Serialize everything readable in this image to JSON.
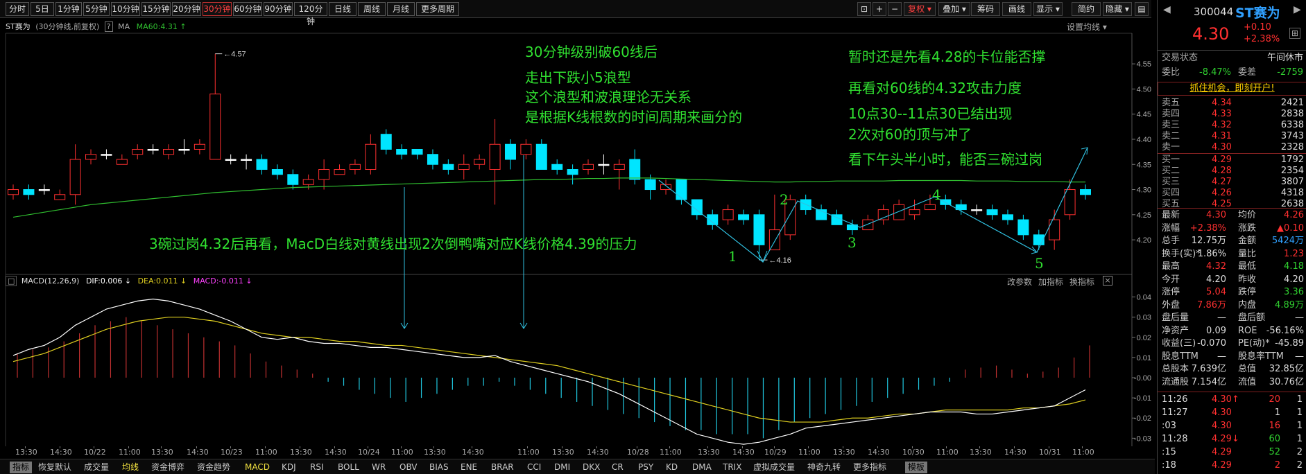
{
  "toolbar": {
    "periods": [
      "分时",
      "5日",
      "1分钟",
      "5分钟",
      "10分钟",
      "15分钟",
      "20分钟",
      "30分钟",
      "60分钟",
      "90分钟",
      "120分钟",
      "日线",
      "周线",
      "月线",
      "更多周期"
    ],
    "active_period": "30分钟",
    "right_buttons": [
      "复权",
      "叠加",
      "筹码",
      "画线",
      "显示",
      "简约",
      "隐藏"
    ]
  },
  "chart_header": {
    "stock_name": "ST赛为",
    "info": "(30分钟线,前复权)",
    "ma_label": "MA",
    "ma_value": "MA60:4.31",
    "settings": "设置均线"
  },
  "price_axis": [
    "4.55",
    "4.50",
    "4.45",
    "4.40",
    "4.35",
    "4.30",
    "4.25",
    "4.20"
  ],
  "high_label": "4.57",
  "low_label": "4.16",
  "annotations": {
    "a1": "30分钟级别破60线后",
    "a2": "走出下跌小5浪型",
    "a3": "这个浪型和波浪理论无关系",
    "a4": "是根据K线根数的时间周期来画分的",
    "a5": "暂时还是先看4.28的卡位能否撑",
    "a6": "再看对60线的4.32攻击力度",
    "a7": "10点30--11点30已结出现",
    "a8": "2次对60的顶与冲了",
    "a9": "看下午头半小时，能否三碗过岗",
    "a10": "3碗过岗4.32后再看，MacD白线对黄线出现2次倒鸭嘴对应K线价格4.39的压力",
    "w1": "1",
    "w2": "2",
    "w3": "3",
    "w4": "4",
    "w5": "5"
  },
  "macd_header": {
    "name": "MACD(12,26,9)",
    "dif": "DIF:0.006",
    "dea": "DEA:0.011",
    "macd": "MACD:-0.011",
    "btn1": "改参数",
    "btn2": "加指标",
    "btn3": "换指标"
  },
  "macd_axis": [
    "0.04",
    "0.03",
    "0.02",
    "0.01",
    "-0.00",
    "-0.01",
    "-0.02",
    "-0.03"
  ],
  "time_axis": [
    "13:30",
    "14:30",
    "10/22",
    "11:00",
    "13:30",
    "14:30",
    "10/23",
    "11:00",
    "13:30",
    "14:30",
    "10/24",
    "11:00",
    "13:30",
    "14:30",
    "11:00",
    "13:30",
    "14:30",
    "10/28",
    "11:00",
    "13:30",
    "14:30",
    "10/29",
    "11:00",
    "13:30",
    "14:30",
    "10/30",
    "11:00",
    "13:30",
    "14:30",
    "10/31",
    "11:00"
  ],
  "indicator_tabs": [
    "指标",
    "恢复默认",
    "成交量",
    "均线",
    "资金博弈",
    "资金趋势",
    "MACD",
    "KDJ",
    "RSI",
    "BOLL",
    "WR",
    "OBV",
    "BIAS",
    "ENE",
    "BRAR",
    "CCI",
    "DMI",
    "DKX",
    "CR",
    "PSY",
    "KD",
    "DMA",
    "TRIX",
    "虚拟成交量",
    "神奇九转",
    "更多指标",
    "模板"
  ],
  "quote": {
    "code": "300044",
    "name": "ST赛为",
    "price": "4.30",
    "change": "+0.10",
    "change_pct": "+2.38%",
    "status_label": "交易状态",
    "status": "午间休市",
    "weibi_label": "委比",
    "weibi": "-8.47%",
    "weicha_label": "委差",
    "weicha": "-2759",
    "promo": "抓住机会，即刻开户!",
    "sells": [
      {
        "label": "卖五",
        "price": "4.34",
        "vol": "2421"
      },
      {
        "label": "卖四",
        "price": "4.33",
        "vol": "2838"
      },
      {
        "label": "卖三",
        "price": "4.32",
        "vol": "6338"
      },
      {
        "label": "卖二",
        "price": "4.31",
        "vol": "3743"
      },
      {
        "label": "卖一",
        "price": "4.30",
        "vol": "2328"
      }
    ],
    "buys": [
      {
        "label": "买一",
        "price": "4.29",
        "vol": "1792"
      },
      {
        "label": "买二",
        "price": "4.28",
        "vol": "2354"
      },
      {
        "label": "买三",
        "price": "4.27",
        "vol": "3807"
      },
      {
        "label": "买四",
        "price": "4.26",
        "vol": "4318"
      },
      {
        "label": "买五",
        "price": "4.25",
        "vol": "2638"
      }
    ],
    "stats": [
      {
        "l1": "最新",
        "v1": "4.30",
        "c1": "red",
        "l2": "均价",
        "v2": "4.26",
        "c2": "red"
      },
      {
        "l1": "涨幅",
        "v1": "+2.38%",
        "c1": "red",
        "l2": "涨跌",
        "v2": "▲0.10",
        "c2": "red"
      },
      {
        "l1": "总手",
        "v1": "12.75万",
        "c1": "wht",
        "l2": "金额",
        "v2": "5424万",
        "c2": "blue"
      },
      {
        "l1": "换手(实)*",
        "v1": "1.86%",
        "c1": "wht",
        "l2": "量比",
        "v2": "1.23",
        "c2": "red"
      },
      {
        "l1": "最高",
        "v1": "4.32",
        "c1": "red",
        "l2": "最低",
        "v2": "4.18",
        "c2": "grn"
      },
      {
        "l1": "今开",
        "v1": "4.20",
        "c1": "wht",
        "l2": "昨收",
        "v2": "4.20",
        "c2": "wht"
      },
      {
        "l1": "涨停",
        "v1": "5.04",
        "c1": "red",
        "l2": "跌停",
        "v2": "3.36",
        "c2": "grn"
      },
      {
        "l1": "外盘",
        "v1": "7.86万",
        "c1": "red",
        "l2": "内盘",
        "v2": "4.89万",
        "c2": "grn"
      },
      {
        "l1": "盘后量",
        "v1": "—",
        "c1": "wht",
        "l2": "盘后额",
        "v2": "—",
        "c2": "wht"
      },
      {
        "l1": "净资产",
        "v1": "0.09",
        "c1": "wht",
        "l2": "ROE",
        "v2": "-56.16%",
        "c2": "wht"
      },
      {
        "l1": "收益(三)",
        "v1": "-0.070",
        "c1": "wht",
        "l2": "PE(动)*",
        "v2": "-45.89",
        "c2": "wht"
      },
      {
        "l1": "股息TTM",
        "v1": "—",
        "c1": "wht",
        "l2": "股息率TTM",
        "v2": "—",
        "c2": "wht"
      },
      {
        "l1": "总股本",
        "v1": "7.639亿",
        "c1": "wht",
        "l2": "总值",
        "v2": "32.85亿",
        "c2": "wht"
      },
      {
        "l1": "流通股",
        "v1": "7.154亿",
        "c1": "wht",
        "l2": "流值",
        "v2": "30.76亿",
        "c2": "wht"
      }
    ],
    "ticks": [
      {
        "t": "11:26",
        "p": "4.30↑",
        "pc": "red",
        "v": "20",
        "vc": "red",
        "n": "1"
      },
      {
        "t": "11:27",
        "p": "4.30",
        "pc": "red",
        "v": "1",
        "vc": "wht",
        "n": "1"
      },
      {
        "t": ":03",
        "p": "4.30",
        "pc": "red",
        "v": "16",
        "vc": "red",
        "n": "1"
      },
      {
        "t": "11:28",
        "p": "4.29↓",
        "pc": "red",
        "v": "60",
        "vc": "grn",
        "n": "1"
      },
      {
        "t": ":15",
        "p": "4.29",
        "pc": "red",
        "v": "52",
        "vc": "grn",
        "n": "2"
      },
      {
        "t": ":18",
        "p": "4.29",
        "pc": "red",
        "v": "2",
        "vc": "red",
        "n": "2"
      }
    ]
  },
  "colors": {
    "up": "#ff3030",
    "down": "#00e5ff",
    "ma60": "#30c030",
    "dif": "#ffffff",
    "dea": "#e0d020",
    "annotation": "#30e030"
  }
}
